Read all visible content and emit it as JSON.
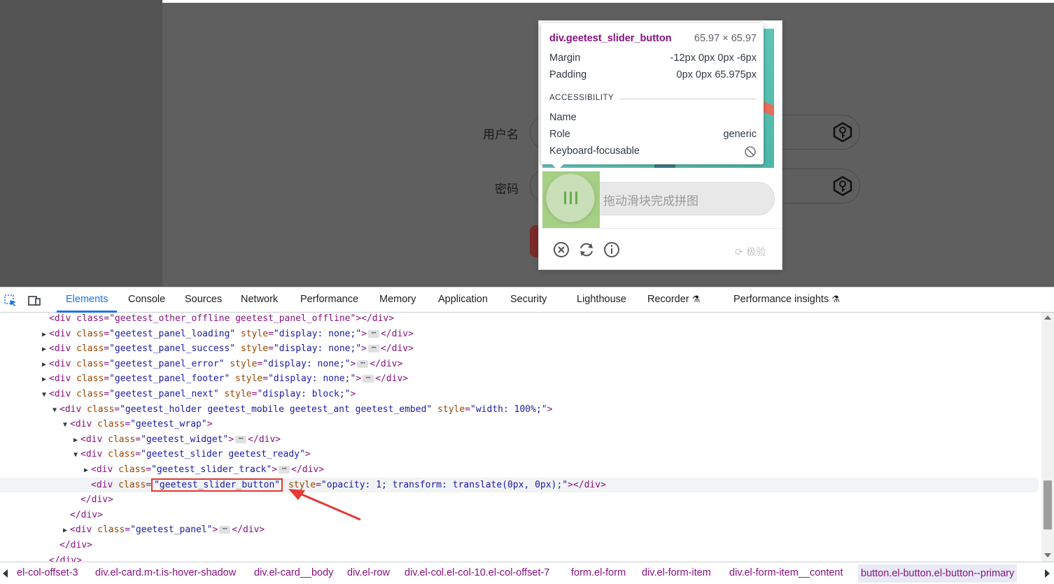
{
  "page": {
    "username_label": "用户名",
    "password_label": "密码"
  },
  "captcha": {
    "slider_text": "拖动滑块完成拼图",
    "brand": "极验",
    "icons": [
      "close-circle-icon",
      "refresh-icon",
      "info-icon"
    ]
  },
  "tooltip": {
    "element": "div.geetest_slider_button",
    "dimensions": "65.97 × 65.97",
    "margin_label": "Margin",
    "margin_value": "-12px 0px 0px -6px",
    "padding_label": "Padding",
    "padding_value": "0px 0px 65.975px",
    "section": "ACCESSIBILITY",
    "name_label": "Name",
    "name_value": "",
    "role_label": "Role",
    "role_value": "generic",
    "keyboard_label": "Keyboard-focusable"
  },
  "devtools": {
    "tabs": [
      "Elements",
      "Console",
      "Sources",
      "Network",
      "Performance",
      "Memory",
      "Application",
      "Security",
      "Lighthouse",
      "Recorder",
      "Performance insights"
    ],
    "active_tab": "Elements",
    "lines": [
      {
        "indent": 0,
        "t": "",
        "open": "<div class=\"geetest_other_offline geetest_panel_offline\"></div>"
      },
      {
        "indent": 0,
        "t": "▶",
        "cls": "geetest_panel_loading",
        "style": "display: none;",
        "collapsed": true
      },
      {
        "indent": 0,
        "t": "▶",
        "cls": "geetest_panel_success",
        "style": "display: none;",
        "collapsed": true
      },
      {
        "indent": 0,
        "t": "▶",
        "cls": "geetest_panel_error",
        "style": "display: none;",
        "collapsed": true
      },
      {
        "indent": 0,
        "t": "▶",
        "cls": "geetest_panel_footer",
        "style": "display: none;",
        "collapsed": true
      },
      {
        "indent": 0,
        "t": "▼",
        "cls": "geetest_panel_next",
        "style": "display: block;",
        "collapsed": false
      },
      {
        "indent": 1,
        "t": "▼",
        "cls": "geetest_holder geetest_mobile geetest_ant geetest_embed",
        "style": "width: 100%;",
        "collapsed": false
      },
      {
        "indent": 2,
        "t": "▼",
        "cls": "geetest_wrap",
        "collapsed": false
      },
      {
        "indent": 3,
        "t": "▶",
        "cls": "geetest_widget",
        "collapsed": true
      },
      {
        "indent": 3,
        "t": "▼",
        "cls": "geetest_slider geetest_ready",
        "collapsed": false
      },
      {
        "indent": 4,
        "t": "▶",
        "cls": "geetest_slider_track",
        "collapsed": true
      },
      {
        "indent": 4,
        "t": "",
        "cls": "geetest_slider_button",
        "style": "opacity: 1; transform: translate(0px, 0px);",
        "collapsed": "empty",
        "selected": true
      },
      {
        "indent": 3,
        "t": "",
        "close": "</div>"
      },
      {
        "indent": 2,
        "t": "",
        "close": "</div>"
      },
      {
        "indent": 2,
        "t": "▶",
        "cls": "geetest_panel",
        "collapsed": true
      },
      {
        "indent": 1,
        "t": "",
        "close": "</div>"
      },
      {
        "indent": 0,
        "t": "",
        "close": "</div>"
      }
    ],
    "breadcrumb": [
      "el-col-offset-3",
      "div.el-card.m-t.is-hover-shadow",
      "div.el-card__body",
      "div.el-row",
      "div.el-col.el-col-10.el-col-offset-7",
      "form.el-form",
      "div.el-form-item",
      "div.el-form-item__content",
      "button.el-button.el-button--primary"
    ]
  }
}
